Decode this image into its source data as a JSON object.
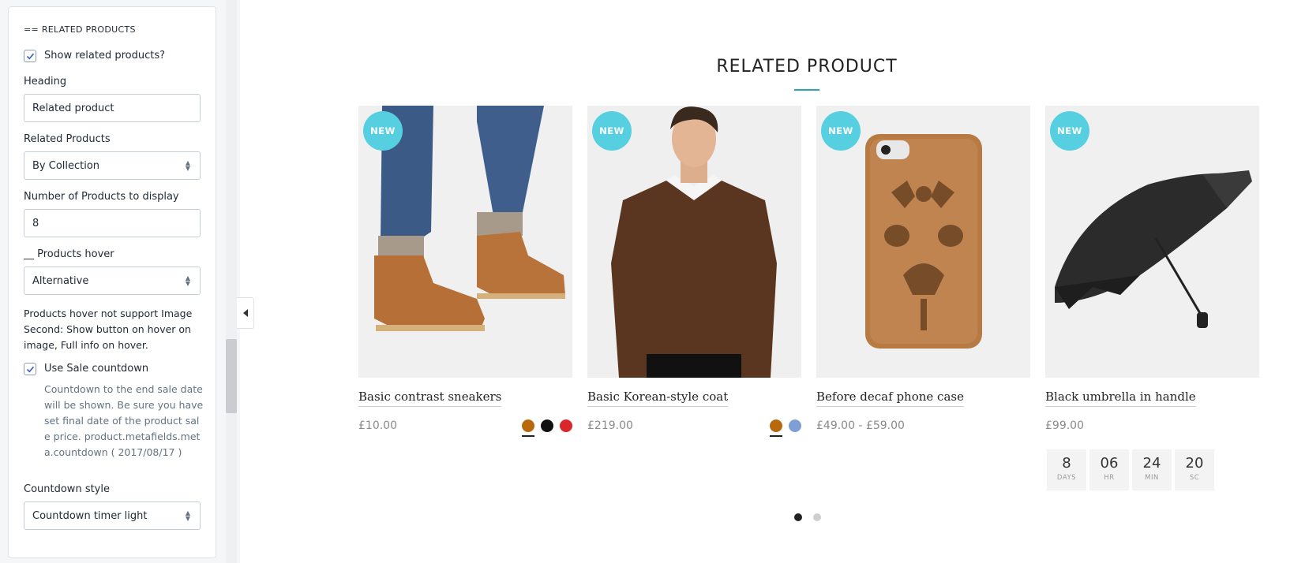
{
  "sidebar": {
    "section_title": "== RELATED PRODUCTS",
    "show_related_label": "Show related products?",
    "show_related_checked": true,
    "heading_label": "Heading",
    "heading_value": "Related product",
    "related_products_label": "Related Products",
    "related_products_value": "By Collection",
    "num_products_label": "Number of Products to display",
    "num_products_value": "8",
    "products_hover_label": "__ Products hover",
    "products_hover_value": "Alternative",
    "hover_help": "Products hover not support Image Second: Show button on hover on image, Full info on hover.",
    "sale_countdown_label": "Use Sale countdown",
    "sale_countdown_checked": true,
    "sale_countdown_help": "Countdown to the end sale date will be shown. Be sure you have set final date of the product sale price. product.metafields.meta.countdown ( 2017/08/17 )",
    "countdown_style_label": "Countdown style",
    "countdown_style_value": "Countdown timer light"
  },
  "preview": {
    "title": "RELATED PRODUCT",
    "accent_color": "#2aa6b2",
    "badge_color": "#56cfe1",
    "products": [
      {
        "badge": "NEW",
        "name": "Basic contrast sneakers",
        "price": "£10.00",
        "swatches": [
          "#b8690e",
          "#111111",
          "#d9262b"
        ]
      },
      {
        "badge": "NEW",
        "name": "Basic Korean-style coat",
        "price": "£219.00",
        "swatches": [
          "#b8690e",
          "#7f9ed3"
        ]
      },
      {
        "badge": "NEW",
        "name": "Before decaf phone case",
        "price": "£49.00 - £59.00",
        "swatches": []
      },
      {
        "badge": "NEW",
        "name": "Black umbrella in handle",
        "price": "£99.00",
        "swatches": []
      }
    ],
    "countdown": [
      {
        "value": "8",
        "unit": "DAYS"
      },
      {
        "value": "06",
        "unit": "HR"
      },
      {
        "value": "24",
        "unit": "MIN"
      },
      {
        "value": "20",
        "unit": "SC"
      }
    ],
    "pagination_active": 1,
    "pagination_count": 2
  }
}
